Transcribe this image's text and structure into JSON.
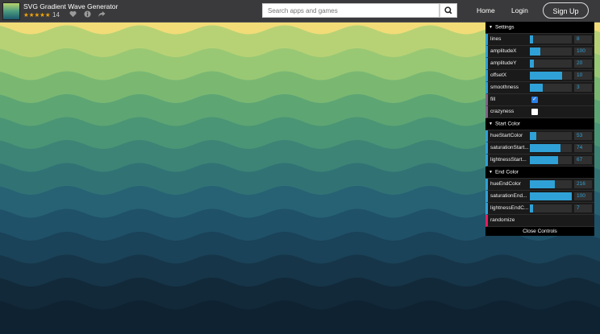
{
  "app": {
    "title": "SVG Gradient Wave Generator",
    "stars": "★★★★★",
    "rating_count": "14",
    "star_color": "#f0a30a"
  },
  "header": {
    "search_placeholder": "Search apps and games",
    "search_icon": "search-icon",
    "nav": {
      "home": "Home",
      "login": "Login",
      "signup": "Sign Up"
    },
    "meta_icons": [
      "heart-icon",
      "info-icon",
      "share-icon"
    ]
  },
  "waves": {
    "top_color": "#f2dc78",
    "bottom_color": "#0d1e2c",
    "band_colors": [
      "#b7d275",
      "#99c874",
      "#7ab872",
      "#5ea574",
      "#4a9575",
      "#3d8476",
      "#317375",
      "#276274",
      "#1f5169",
      "#1a4258",
      "#163548",
      "#12293a",
      "#0f2232"
    ]
  },
  "controls": {
    "settings": {
      "title": "Settings",
      "lines": {
        "label": "lines",
        "value": 8,
        "max": 100
      },
      "amplitudeX": {
        "label": "amplitudeX",
        "value": 100,
        "max": 400
      },
      "amplitudeY": {
        "label": "amplitudeY",
        "value": 20,
        "max": 200
      },
      "offsetX": {
        "label": "offsetX",
        "value": 10,
        "max": 13
      },
      "smoothness": {
        "label": "smoothness",
        "value": 3,
        "max": 10
      },
      "fill": {
        "label": "fill",
        "checked": true
      },
      "crazyness": {
        "label": "crazyness",
        "checked": false
      }
    },
    "start_color": {
      "title": "Start Color",
      "hue": {
        "label": "hueStartColor",
        "value": 53,
        "max": 360
      },
      "saturation": {
        "label": "saturationStart...",
        "value": 74,
        "max": 100
      },
      "lightness": {
        "label": "lightnessStart...",
        "value": 67,
        "max": 100
      }
    },
    "end_color": {
      "title": "End Color",
      "hue": {
        "label": "hueEndColor",
        "value": 216,
        "max": 360
      },
      "saturation": {
        "label": "saturationEnd...",
        "value": 100,
        "max": 100
      },
      "lightness": {
        "label": "lightnessEndC...",
        "value": 7,
        "max": 100
      }
    },
    "randomize": "randomize",
    "close": "Close Controls",
    "accent": "#2fa1d6"
  }
}
